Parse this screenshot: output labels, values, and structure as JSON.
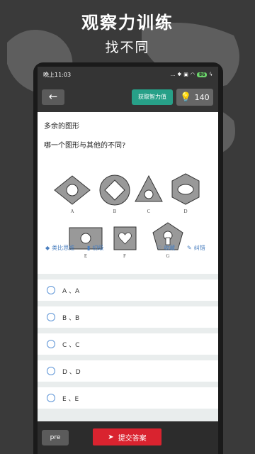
{
  "promo": {
    "title": "观察力训练",
    "subtitle": "找不同"
  },
  "statusbar": {
    "time": "晚上11:03",
    "signal": "...",
    "battery": "86"
  },
  "toolbar": {
    "back_icon": "arrow-left-icon",
    "wisdom_label": "获取智力值",
    "score": "140"
  },
  "question": {
    "category": "多余的图形",
    "text": "哪一个图形与其他的不同?",
    "figure_labels": [
      "A",
      "B",
      "C",
      "D",
      "E",
      "F",
      "G"
    ]
  },
  "tags": {
    "type_label": "类比思维",
    "level_label": "初级",
    "favorite_label": "收藏",
    "report_label": "纠错"
  },
  "options": [
    {
      "label": "A 、A"
    },
    {
      "label": "B 、B"
    },
    {
      "label": "C 、C"
    },
    {
      "label": "D 、D"
    },
    {
      "label": "E 、E"
    }
  ],
  "bottom": {
    "pre_label": "pre",
    "submit_label": "提交答案"
  },
  "colors": {
    "accent_green": "#27a088",
    "submit_red": "#d9232f",
    "link_blue": "#4a7fbf"
  }
}
